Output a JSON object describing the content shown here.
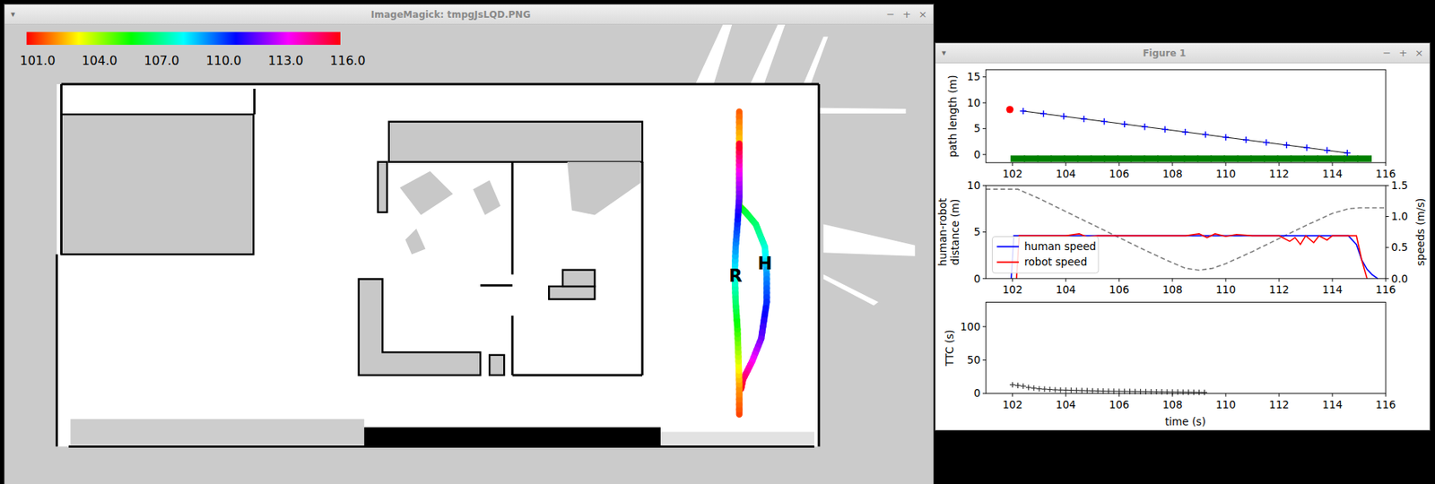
{
  "map_window": {
    "title": "ImageMagick: tmpgJsLQD.PNG",
    "menu_glyph": "▾",
    "controls": [
      "−",
      "+",
      "×"
    ],
    "colorbar": {
      "t_min": 101,
      "t_max": 116,
      "ticks": [
        "101.0",
        "104.0",
        "107.0",
        "110.0",
        "113.0",
        "116.0"
      ]
    },
    "paths": [
      {
        "name": "human",
        "label": "H",
        "points": [
          [
            808,
            122,
            101.8
          ],
          [
            808,
            157,
            103
          ],
          [
            808,
            225,
            105
          ],
          [
            815,
            232,
            106.5
          ],
          [
            826,
            245,
            107
          ],
          [
            836,
            270,
            108
          ],
          [
            838,
            300,
            109.5
          ],
          [
            838,
            330,
            110.5
          ],
          [
            832,
            370,
            112
          ],
          [
            822,
            395,
            113.5
          ],
          [
            812,
            415,
            115
          ],
          [
            810,
            425,
            115.8
          ]
        ]
      },
      {
        "name": "robot",
        "label": "R",
        "points": [
          [
            808,
            453,
            101.6
          ],
          [
            808,
            420,
            102.5
          ],
          [
            807,
            390,
            104
          ],
          [
            806,
            360,
            105.5
          ],
          [
            804,
            330,
            107
          ],
          [
            803,
            300,
            108.3
          ],
          [
            804,
            270,
            109.5
          ],
          [
            806,
            245,
            110.5
          ],
          [
            808,
            215,
            112
          ],
          [
            808,
            185,
            113.5
          ],
          [
            808,
            157,
            115.8
          ]
        ]
      }
    ]
  },
  "figure_window": {
    "title": "Figure 1",
    "menu_glyph": "▾",
    "controls": [
      "−",
      "+",
      "×"
    ],
    "x_ticks": [
      "102",
      "104",
      "106",
      "108",
      "110",
      "112",
      "114",
      "116"
    ],
    "x_label": "time (s)",
    "path_plot": {
      "y_label": "path length (m)",
      "y_ticks": [
        "0",
        "5",
        "10",
        "15"
      ],
      "start_point": [
        101.9,
        8.7
      ],
      "start_color": "#ff0000",
      "path_color": "#0000ff",
      "path": [
        [
          102.4,
          8.4
        ],
        [
          103.16,
          7.89
        ],
        [
          103.92,
          7.39
        ],
        [
          104.68,
          6.88
        ],
        [
          105.44,
          6.38
        ],
        [
          106.2,
          5.87
        ],
        [
          106.96,
          5.36
        ],
        [
          107.72,
          4.86
        ],
        [
          108.48,
          4.35
        ],
        [
          109.24,
          3.85
        ],
        [
          110.0,
          3.34
        ],
        [
          110.76,
          2.83
        ],
        [
          111.52,
          2.33
        ],
        [
          112.28,
          1.82
        ],
        [
          113.04,
          1.32
        ],
        [
          113.8,
          0.81
        ],
        [
          114.56,
          0.3
        ]
      ],
      "coverage_color": "#008000",
      "coverage": [
        [
          102.2,
          -0.8
        ],
        [
          102.7,
          -0.8
        ],
        [
          103.2,
          -0.8
        ],
        [
          103.7,
          -0.8
        ],
        [
          104.2,
          -0.8
        ],
        [
          104.7,
          -0.8
        ],
        [
          105.2,
          -0.8
        ],
        [
          105.7,
          -0.8
        ],
        [
          106.2,
          -0.8
        ],
        [
          106.7,
          -0.8
        ],
        [
          107.2,
          -0.8
        ],
        [
          107.7,
          -0.8
        ],
        [
          108.2,
          -0.8
        ],
        [
          108.7,
          -0.8
        ],
        [
          109.2,
          -0.8
        ],
        [
          109.7,
          -0.8
        ],
        [
          110.2,
          -0.8
        ],
        [
          110.7,
          -0.8
        ],
        [
          111.2,
          -0.8
        ],
        [
          111.7,
          -0.8
        ],
        [
          112.2,
          -0.8
        ],
        [
          112.7,
          -0.8
        ],
        [
          113.2,
          -0.8
        ],
        [
          113.7,
          -0.8
        ],
        [
          114.2,
          -0.8
        ],
        [
          114.7,
          -0.8
        ],
        [
          115.2,
          -0.8
        ]
      ]
    },
    "speed_plot": {
      "y_label_lines": [
        "human-robot",
        "distance (m)"
      ],
      "y2_label": "speeds (m/s)",
      "y_ticks": [
        "0",
        "5",
        "10"
      ],
      "y2_ticks": [
        "0.0",
        "0.5",
        "1.0",
        "1.5"
      ],
      "distance": [
        [
          101,
          9.6
        ],
        [
          102.2,
          9.6
        ],
        [
          103,
          8.6
        ],
        [
          104,
          7.2
        ],
        [
          105,
          5.8
        ],
        [
          106,
          4.4
        ],
        [
          107,
          3.0
        ],
        [
          108,
          1.7
        ],
        [
          108.5,
          1.1
        ],
        [
          109,
          0.9
        ],
        [
          109.5,
          1.1
        ],
        [
          110,
          1.6
        ],
        [
          111,
          2.9
        ],
        [
          112,
          4.3
        ],
        [
          113,
          5.7
        ],
        [
          114,
          7.0
        ],
        [
          114.6,
          7.5
        ],
        [
          115,
          7.6
        ],
        [
          116,
          7.6
        ]
      ],
      "series": [
        {
          "label": "human speed",
          "color": "#0000ff",
          "points": [
            [
              101.95,
              0
            ],
            [
              102.05,
              0.69
            ],
            [
              114.6,
              0.69
            ],
            [
              114.9,
              0.55
            ],
            [
              115.1,
              0.3
            ],
            [
              115.3,
              0.15
            ],
            [
              115.5,
              0.06
            ],
            [
              115.7,
              0
            ]
          ]
        },
        {
          "label": "robot speed",
          "color": "#ff0000",
          "points": [
            [
              102.15,
              0
            ],
            [
              102.25,
              0.69
            ],
            [
              104,
              0.69
            ],
            [
              104.5,
              0.72
            ],
            [
              104.8,
              0.67
            ],
            [
              105.2,
              0.69
            ],
            [
              108.5,
              0.69
            ],
            [
              109,
              0.72
            ],
            [
              109.3,
              0.66
            ],
            [
              109.6,
              0.72
            ],
            [
              110,
              0.68
            ],
            [
              110.4,
              0.71
            ],
            [
              111,
              0.69
            ],
            [
              112,
              0.69
            ],
            [
              112.4,
              0.6
            ],
            [
              112.6,
              0.66
            ],
            [
              112.8,
              0.55
            ],
            [
              113,
              0.69
            ],
            [
              113.3,
              0.58
            ],
            [
              113.5,
              0.69
            ],
            [
              113.8,
              0.62
            ],
            [
              114,
              0.69
            ],
            [
              114.9,
              0.69
            ],
            [
              115.1,
              0.3
            ],
            [
              115.3,
              0
            ]
          ]
        }
      ]
    },
    "ttc_plot": {
      "y_label": "TTC (s)",
      "y_ticks": [
        "0",
        "50",
        "100"
      ],
      "points": [
        [
          102.0,
          13
        ],
        [
          102.2,
          12
        ],
        [
          102.4,
          11
        ],
        [
          102.6,
          9
        ],
        [
          102.8,
          8
        ],
        [
          103.0,
          7
        ],
        [
          103.2,
          6.5
        ],
        [
          103.4,
          6
        ],
        [
          103.6,
          5.5
        ],
        [
          103.8,
          5.2
        ],
        [
          104.0,
          5
        ],
        [
          104.2,
          4.8
        ],
        [
          104.4,
          4.6
        ],
        [
          104.6,
          4.4
        ],
        [
          104.8,
          4.2
        ],
        [
          105.0,
          4
        ],
        [
          105.2,
          3.8
        ],
        [
          105.4,
          3.6
        ],
        [
          105.6,
          3.4
        ],
        [
          105.8,
          3.3
        ],
        [
          106.0,
          3.2
        ],
        [
          106.2,
          3.1
        ],
        [
          106.4,
          3
        ],
        [
          106.6,
          2.9
        ],
        [
          106.8,
          2.8
        ],
        [
          107.0,
          2.7
        ],
        [
          107.2,
          2.6
        ],
        [
          107.4,
          2.5
        ],
        [
          107.6,
          2.4
        ],
        [
          107.8,
          2.3
        ],
        [
          108.0,
          2.2
        ],
        [
          108.2,
          2.1
        ],
        [
          108.4,
          2
        ],
        [
          108.6,
          1.9
        ],
        [
          108.8,
          1.8
        ],
        [
          109.0,
          1.7
        ],
        [
          109.2,
          1.6
        ]
      ]
    }
  }
}
